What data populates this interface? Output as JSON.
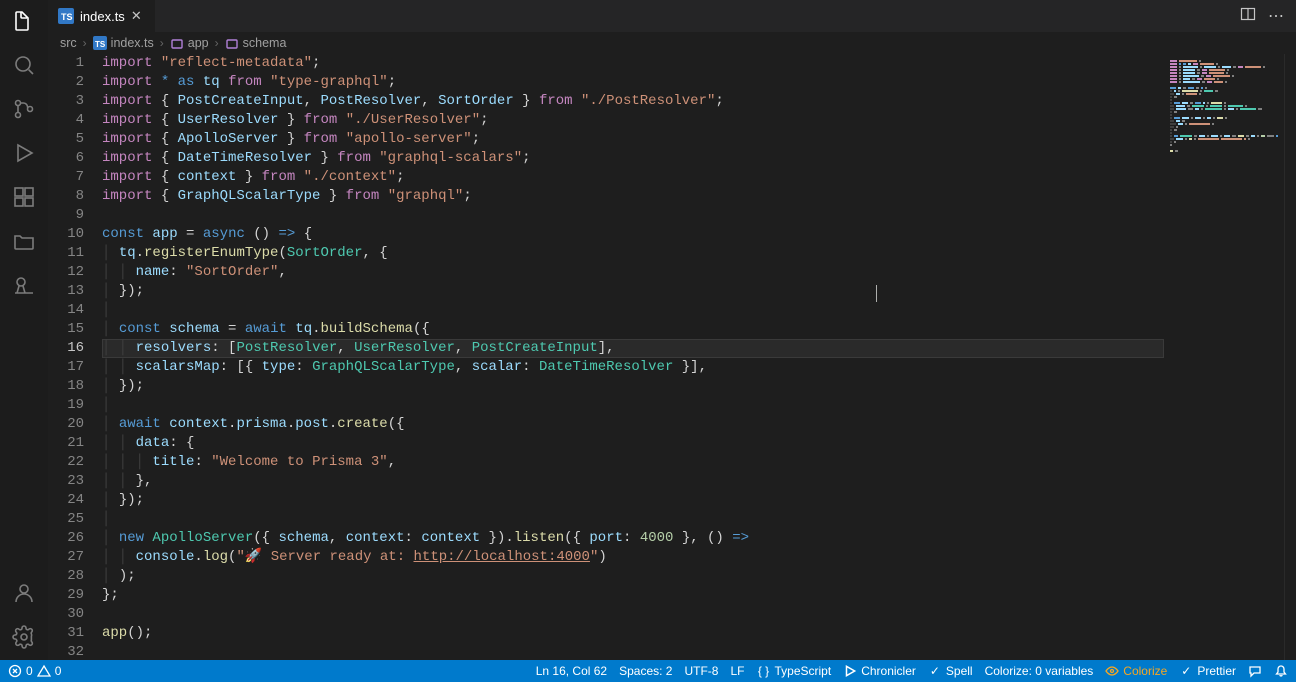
{
  "tabs": {
    "file": "index.ts",
    "actions_more": "⋯"
  },
  "breadcrumbs": {
    "items": [
      "src",
      "index.ts",
      "app",
      "schema"
    ]
  },
  "code": {
    "active_line": 16,
    "lines": [
      {
        "n": 1,
        "spans": [
          [
            "k",
            "import "
          ],
          [
            "s",
            "\"reflect-metadata\""
          ],
          [
            "p",
            ";"
          ]
        ]
      },
      {
        "n": 2,
        "spans": [
          [
            "k",
            "import "
          ],
          [
            "kw2",
            "* "
          ],
          [
            "kw2",
            "as "
          ],
          [
            "id",
            "tq "
          ],
          [
            "k",
            "from "
          ],
          [
            "s",
            "\"type-graphql\""
          ],
          [
            "p",
            ";"
          ]
        ]
      },
      {
        "n": 3,
        "spans": [
          [
            "k",
            "import "
          ],
          [
            "p",
            "{ "
          ],
          [
            "id",
            "PostCreateInput"
          ],
          [
            "p",
            ", "
          ],
          [
            "id",
            "PostResolver"
          ],
          [
            "p",
            ", "
          ],
          [
            "id",
            "SortOrder"
          ],
          [
            "p",
            " } "
          ],
          [
            "k",
            "from "
          ],
          [
            "s",
            "\"./PostResolver\""
          ],
          [
            "p",
            ";"
          ]
        ]
      },
      {
        "n": 4,
        "spans": [
          [
            "k",
            "import "
          ],
          [
            "p",
            "{ "
          ],
          [
            "id",
            "UserResolver"
          ],
          [
            "p",
            " } "
          ],
          [
            "k",
            "from "
          ],
          [
            "s",
            "\"./UserResolver\""
          ],
          [
            "p",
            ";"
          ]
        ]
      },
      {
        "n": 5,
        "spans": [
          [
            "k",
            "import "
          ],
          [
            "p",
            "{ "
          ],
          [
            "id",
            "ApolloServer"
          ],
          [
            "p",
            " } "
          ],
          [
            "k",
            "from "
          ],
          [
            "s",
            "\"apollo-server\""
          ],
          [
            "p",
            ";"
          ]
        ]
      },
      {
        "n": 6,
        "spans": [
          [
            "k",
            "import "
          ],
          [
            "p",
            "{ "
          ],
          [
            "id",
            "DateTimeResolver"
          ],
          [
            "p",
            " } "
          ],
          [
            "k",
            "from "
          ],
          [
            "s",
            "\"graphql-scalars\""
          ],
          [
            "p",
            ";"
          ]
        ]
      },
      {
        "n": 7,
        "spans": [
          [
            "k",
            "import "
          ],
          [
            "p",
            "{ "
          ],
          [
            "id",
            "context"
          ],
          [
            "p",
            " } "
          ],
          [
            "k",
            "from "
          ],
          [
            "s",
            "\"./context\""
          ],
          [
            "p",
            ";"
          ]
        ]
      },
      {
        "n": 8,
        "spans": [
          [
            "k",
            "import "
          ],
          [
            "p",
            "{ "
          ],
          [
            "id",
            "GraphQLScalarType"
          ],
          [
            "p",
            " } "
          ],
          [
            "k",
            "from "
          ],
          [
            "s",
            "\"graphql\""
          ],
          [
            "p",
            ";"
          ]
        ]
      },
      {
        "n": 9,
        "spans": []
      },
      {
        "n": 10,
        "spans": [
          [
            "kw2",
            "const "
          ],
          [
            "id",
            "app"
          ],
          [
            "p",
            " = "
          ],
          [
            "kw2",
            "async "
          ],
          [
            "p",
            "() "
          ],
          [
            "kw2",
            "=>"
          ],
          [
            "p",
            " {"
          ]
        ]
      },
      {
        "n": 11,
        "spans": [
          [
            "guide",
            "│ "
          ],
          [
            "id",
            "tq"
          ],
          [
            "p",
            "."
          ],
          [
            "fn",
            "registerEnumType"
          ],
          [
            "p",
            "("
          ],
          [
            "ty",
            "SortOrder"
          ],
          [
            "p",
            ", {"
          ]
        ]
      },
      {
        "n": 12,
        "spans": [
          [
            "guide",
            "│ │ "
          ],
          [
            "id",
            "name"
          ],
          [
            "p",
            ": "
          ],
          [
            "s",
            "\"SortOrder\""
          ],
          [
            "p",
            ","
          ]
        ]
      },
      {
        "n": 13,
        "spans": [
          [
            "guide",
            "│ "
          ],
          [
            "p",
            "});"
          ]
        ]
      },
      {
        "n": 14,
        "spans": [
          [
            "guide",
            "│"
          ]
        ]
      },
      {
        "n": 15,
        "spans": [
          [
            "guide",
            "│ "
          ],
          [
            "kw2",
            "const "
          ],
          [
            "id",
            "schema"
          ],
          [
            "p",
            " = "
          ],
          [
            "kw2",
            "await "
          ],
          [
            "id",
            "tq"
          ],
          [
            "p",
            "."
          ],
          [
            "fn",
            "buildSchema"
          ],
          [
            "p",
            "({"
          ]
        ]
      },
      {
        "n": 16,
        "spans": [
          [
            "guide",
            "│ │ "
          ],
          [
            "id",
            "resolvers"
          ],
          [
            "p",
            ": ["
          ],
          [
            "ty",
            "PostResolver"
          ],
          [
            "p",
            ", "
          ],
          [
            "ty",
            "UserResolver"
          ],
          [
            "p",
            ", "
          ],
          [
            "ty",
            "PostCreateInput"
          ],
          [
            "p",
            "],"
          ]
        ]
      },
      {
        "n": 17,
        "spans": [
          [
            "guide",
            "│ │ "
          ],
          [
            "id",
            "scalarsMap"
          ],
          [
            "p",
            ": [{ "
          ],
          [
            "id",
            "type"
          ],
          [
            "p",
            ": "
          ],
          [
            "ty",
            "GraphQLScalarType"
          ],
          [
            "p",
            ", "
          ],
          [
            "id",
            "scalar"
          ],
          [
            "p",
            ": "
          ],
          [
            "ty",
            "DateTimeResolver"
          ],
          [
            "p",
            " }],"
          ]
        ]
      },
      {
        "n": 18,
        "spans": [
          [
            "guide",
            "│ "
          ],
          [
            "p",
            "});"
          ]
        ]
      },
      {
        "n": 19,
        "spans": [
          [
            "guide",
            "│"
          ]
        ]
      },
      {
        "n": 20,
        "spans": [
          [
            "guide",
            "│ "
          ],
          [
            "kw2",
            "await "
          ],
          [
            "id",
            "context"
          ],
          [
            "p",
            "."
          ],
          [
            "id",
            "prisma"
          ],
          [
            "p",
            "."
          ],
          [
            "id",
            "post"
          ],
          [
            "p",
            "."
          ],
          [
            "fn",
            "create"
          ],
          [
            "p",
            "({"
          ]
        ]
      },
      {
        "n": 21,
        "spans": [
          [
            "guide",
            "│ │ "
          ],
          [
            "id",
            "data"
          ],
          [
            "p",
            ": {"
          ]
        ]
      },
      {
        "n": 22,
        "spans": [
          [
            "guide",
            "│ │ │ "
          ],
          [
            "id",
            "title"
          ],
          [
            "p",
            ": "
          ],
          [
            "s",
            "\"Welcome to Prisma 3\""
          ],
          [
            "p",
            ","
          ]
        ]
      },
      {
        "n": 23,
        "spans": [
          [
            "guide",
            "│ │ "
          ],
          [
            "p",
            "},"
          ]
        ]
      },
      {
        "n": 24,
        "spans": [
          [
            "guide",
            "│ "
          ],
          [
            "p",
            "});"
          ]
        ]
      },
      {
        "n": 25,
        "spans": [
          [
            "guide",
            "│"
          ]
        ]
      },
      {
        "n": 26,
        "spans": [
          [
            "guide",
            "│ "
          ],
          [
            "kw2",
            "new "
          ],
          [
            "ty",
            "ApolloServer"
          ],
          [
            "p",
            "({ "
          ],
          [
            "id",
            "schema"
          ],
          [
            "p",
            ", "
          ],
          [
            "id",
            "context"
          ],
          [
            "p",
            ": "
          ],
          [
            "id",
            "context"
          ],
          [
            "p",
            " })."
          ],
          [
            "fn",
            "listen"
          ],
          [
            "p",
            "({ "
          ],
          [
            "id",
            "port"
          ],
          [
            "p",
            ": "
          ],
          [
            "num",
            "4000"
          ],
          [
            "p",
            " }, () "
          ],
          [
            "kw2",
            "=>"
          ]
        ]
      },
      {
        "n": 27,
        "spans": [
          [
            "guide",
            "│ │ "
          ],
          [
            "id",
            "console"
          ],
          [
            "p",
            "."
          ],
          [
            "fn",
            "log"
          ],
          [
            "p",
            "("
          ],
          [
            "s",
            "\"🚀 Server ready at: "
          ],
          [
            "s url",
            "http://localhost:4000"
          ],
          [
            "s",
            "\""
          ],
          [
            "p",
            ")"
          ]
        ]
      },
      {
        "n": 28,
        "spans": [
          [
            "guide",
            "│ "
          ],
          [
            "p",
            ");"
          ]
        ]
      },
      {
        "n": 29,
        "spans": [
          [
            "p",
            "};"
          ]
        ]
      },
      {
        "n": 30,
        "spans": []
      },
      {
        "n": 31,
        "spans": [
          [
            "fn",
            "app"
          ],
          [
            "p",
            "();"
          ]
        ]
      },
      {
        "n": 32,
        "spans": []
      }
    ]
  },
  "status": {
    "errors": "0",
    "warnings": "0",
    "line_col": "Ln 16, Col 62",
    "spaces": "Spaces: 2",
    "encoding": "UTF-8",
    "eol": "LF",
    "language": "TypeScript",
    "chronicler": "Chronicler",
    "spell": "Spell",
    "colorize_vars": "Colorize: 0 variables",
    "colorize": "Colorize",
    "prettier": "Prettier"
  }
}
